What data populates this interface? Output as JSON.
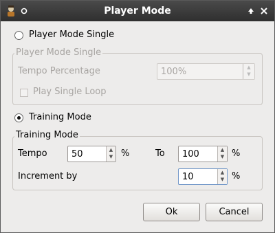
{
  "window": {
    "title": "Player Mode"
  },
  "player_mode_single": {
    "radio_label": "Player Mode Single",
    "group_title": "Player Mode Single",
    "tempo_label": "Tempo Percentage",
    "tempo_value": "100%",
    "loop_label": "Play Single Loop"
  },
  "training_mode": {
    "radio_label": "Training Mode",
    "group_title": "Training Mode",
    "tempo_label": "Tempo",
    "tempo_value": "50",
    "percent_sign_1": "%",
    "to_label": "To",
    "to_value": "100",
    "percent_sign_2": "%",
    "increment_label": "Increment by",
    "increment_value": "10",
    "percent_sign_3": "%"
  },
  "buttons": {
    "ok": "Ok",
    "cancel": "Cancel"
  }
}
